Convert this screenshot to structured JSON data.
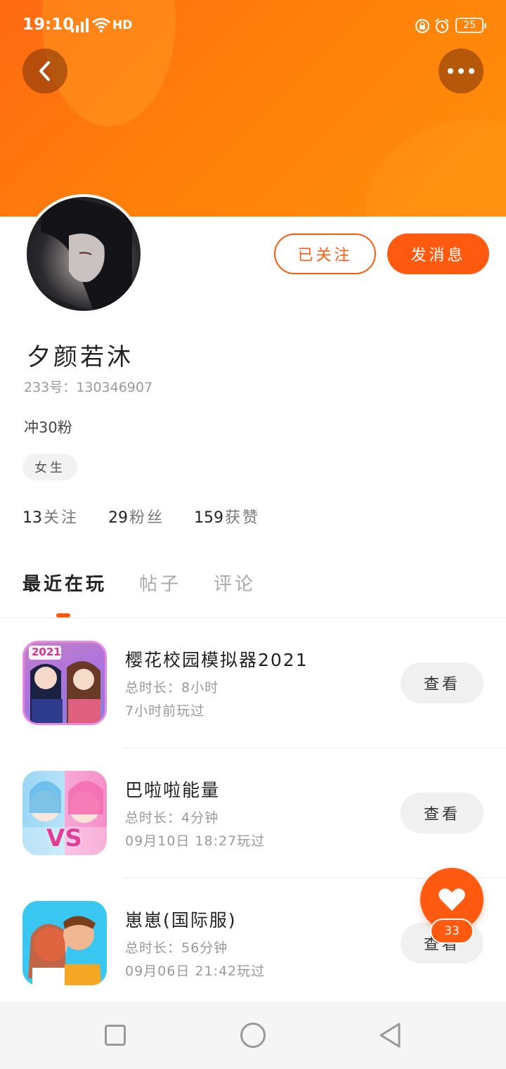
{
  "status_bar": {
    "time": "19:10",
    "network": "4G",
    "hd": "HD",
    "battery": "25"
  },
  "header": {
    "back_icon": "back-arrow-icon",
    "more_icon": "more-dots-icon",
    "accent_color": "#ff6a13"
  },
  "actions": {
    "follow_label": "已关注",
    "message_label": "发消息"
  },
  "profile": {
    "username": "夕颜若沐",
    "user_id": "233号：130346907",
    "bio": "冲30粉",
    "gender": "女生"
  },
  "stats": [
    {
      "count": "13",
      "label": "关注"
    },
    {
      "count": "29",
      "label": "粉丝"
    },
    {
      "count": "159",
      "label": "获赞"
    }
  ],
  "tabs": [
    {
      "label": "最近在玩",
      "active": true
    },
    {
      "label": "帖子",
      "active": false
    },
    {
      "label": "评论",
      "active": false
    }
  ],
  "games": [
    {
      "title": "樱花校园模拟器2021",
      "duration": "总时长：8小时",
      "last_played": "7小时前玩过",
      "button": "查看",
      "icon_badge": "2021"
    },
    {
      "title": "巴啦啦能量",
      "duration": "总时长：4分钟",
      "last_played": "09月10日 18:27玩过",
      "button": "查看",
      "icon_badge": "VS"
    },
    {
      "title": "崽崽(国际服)",
      "duration": "总时长：56分钟",
      "last_played": "09月06日 21:42玩过",
      "button": "查看",
      "icon_badge": ""
    }
  ],
  "like": {
    "icon": "heart-icon",
    "count": "33"
  }
}
